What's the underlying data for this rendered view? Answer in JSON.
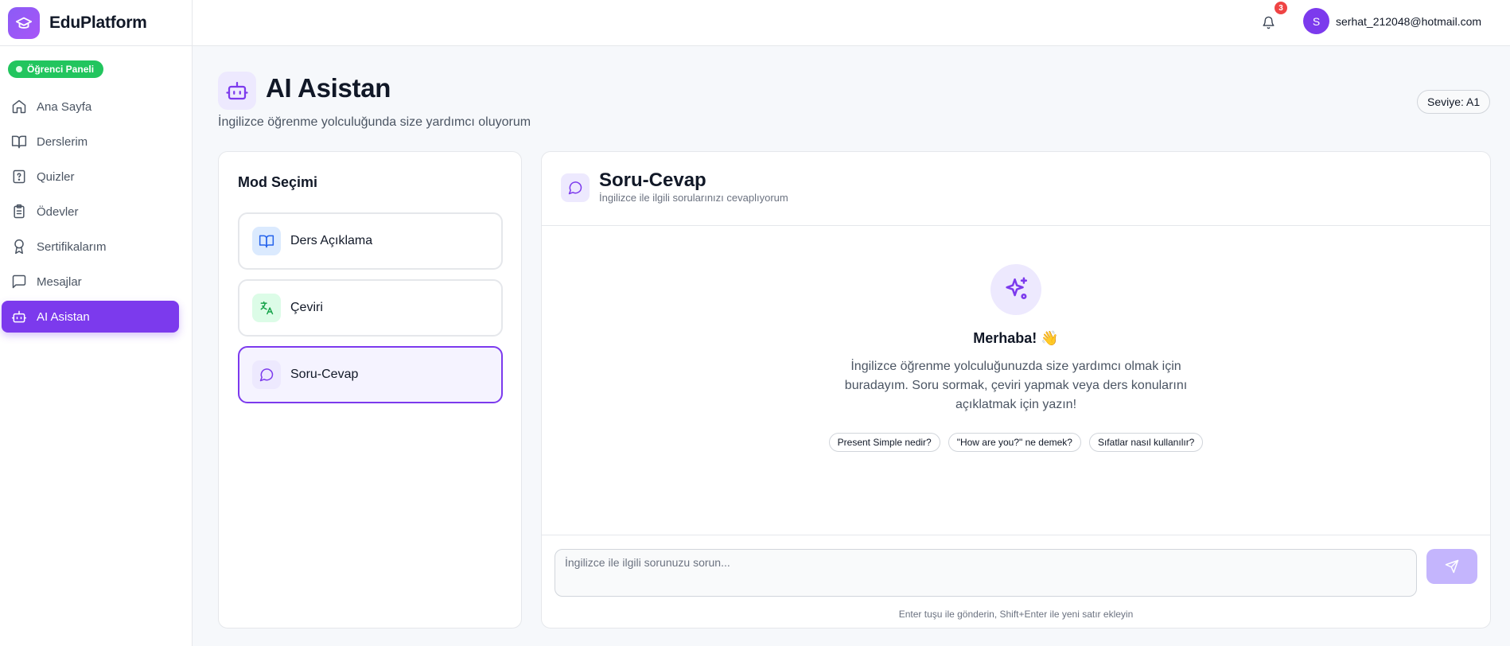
{
  "brand": {
    "name": "EduPlatform",
    "icon": "graduation-cap-icon",
    "accent": "#7c3aed"
  },
  "role_badge": "Öğrenci Paneli",
  "sidebar": {
    "items": [
      {
        "label": "Ana Sayfa",
        "icon": "home-icon"
      },
      {
        "label": "Derslerim",
        "icon": "book-open-icon"
      },
      {
        "label": "Quizler",
        "icon": "help-file-icon"
      },
      {
        "label": "Ödevler",
        "icon": "clipboard-list-icon"
      },
      {
        "label": "Sertifikalarım",
        "icon": "award-icon"
      },
      {
        "label": "Mesajlar",
        "icon": "message-square-icon"
      },
      {
        "label": "AI Asistan",
        "icon": "bot-icon",
        "active": true
      }
    ]
  },
  "topbar": {
    "notifications_count": "3",
    "user": {
      "avatar_letter": "S",
      "email": "serhat_212048@hotmail.com"
    }
  },
  "page": {
    "title": "AI Asistan",
    "subtitle": "İngilizce öğrenme yolculuğunda size yardımcı oluyorum",
    "level": "Seviye: A1"
  },
  "modes": {
    "title": "Mod Seçimi",
    "items": [
      {
        "label": "Ders Açıklama",
        "icon": "book-open-icon"
      },
      {
        "label": "Çeviri",
        "icon": "translate-icon"
      },
      {
        "label": "Soru-Cevap",
        "icon": "message-circle-icon",
        "selected": true
      }
    ]
  },
  "chat": {
    "title": "Soru-Cevap",
    "subtitle": "İngilizce ile ilgili sorularınızı cevaplıyorum",
    "welcome_title": "Merhaba! 👋",
    "welcome_text": "İngilizce öğrenme yolculuğunuzda size yardımcı olmak için buradayım. Soru sormak, çeviri yapmak veya ders konularını açıklatmak için yazın!",
    "suggestions": [
      "Present Simple nedir?",
      "\"How are you?\" ne demek?",
      "Sıfatlar nasıl kullanılır?"
    ],
    "input_placeholder": "İngilizce ile ilgili sorunuzu sorun...",
    "hint": "Enter tuşu ile gönderin, Shift+Enter ile yeni satır ekleyin"
  }
}
